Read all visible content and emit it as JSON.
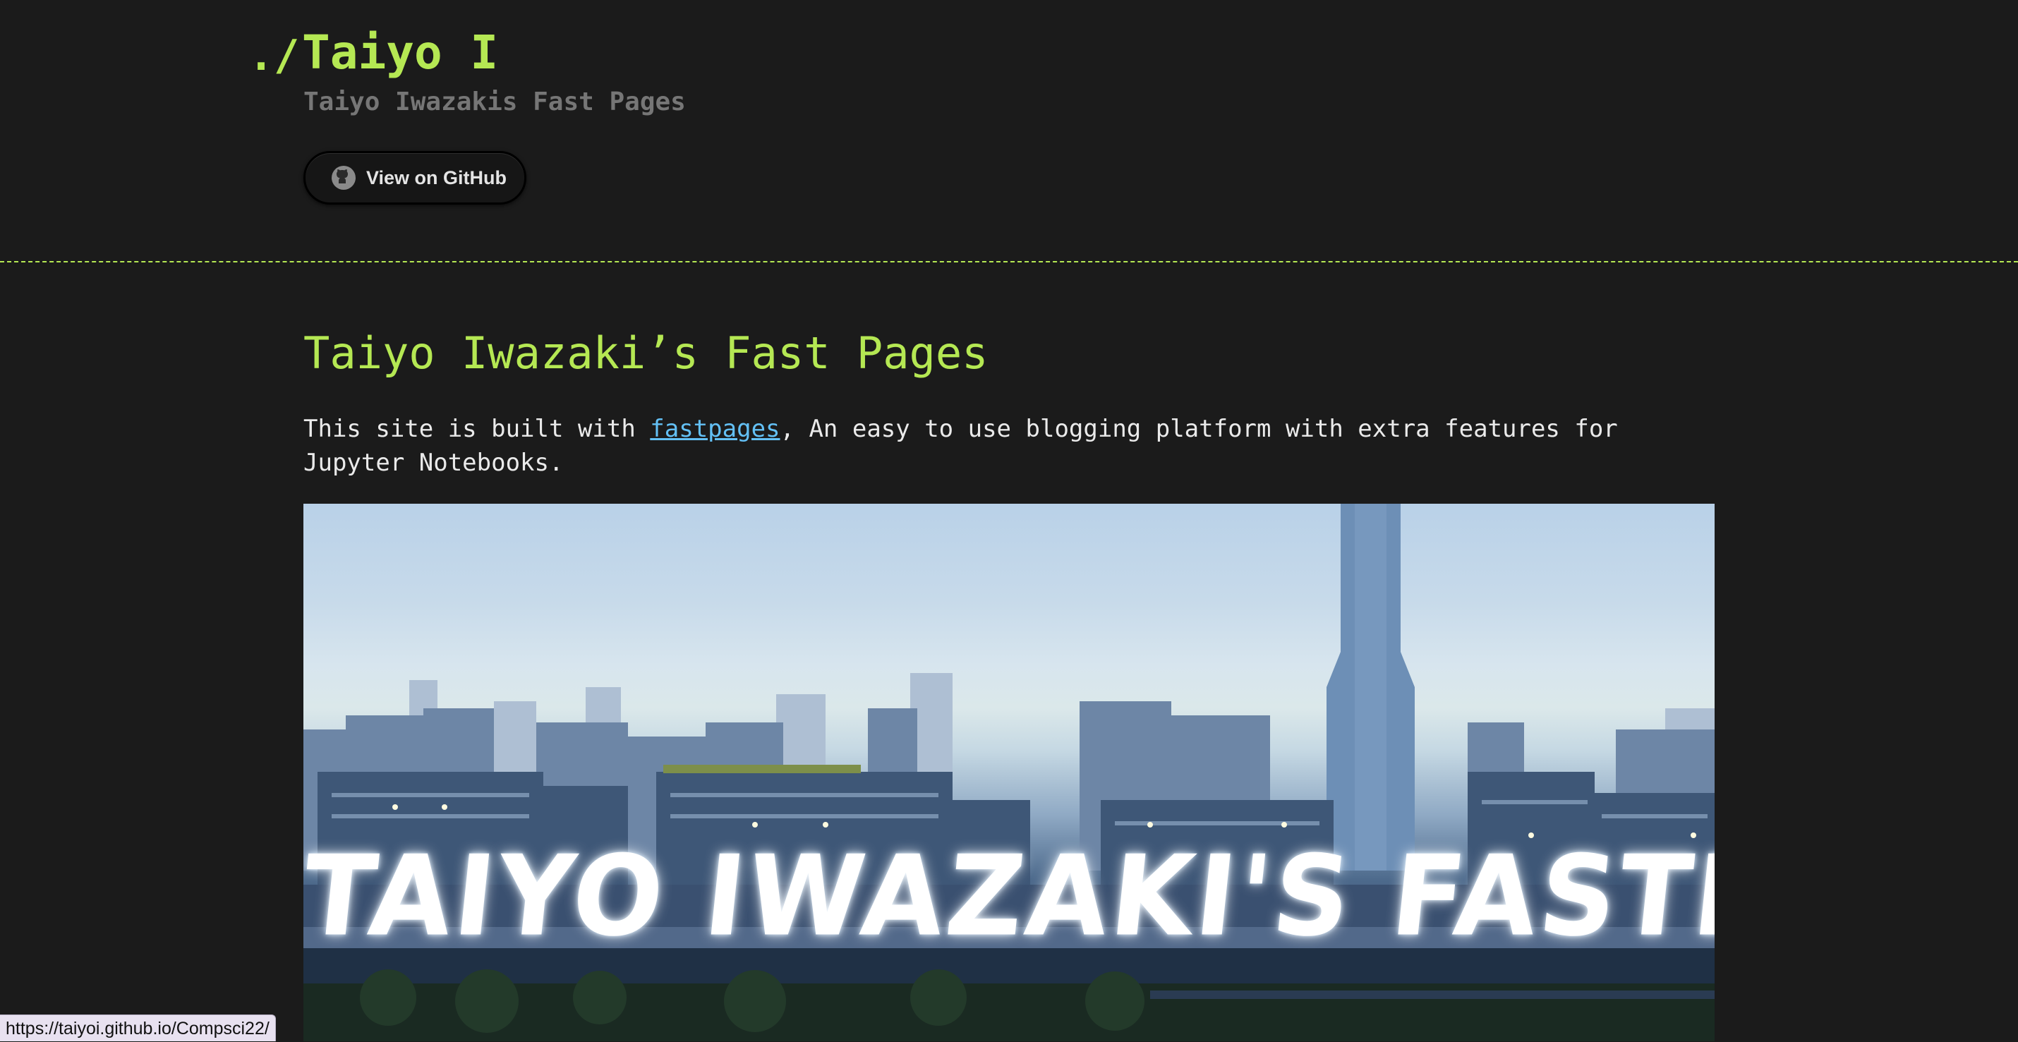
{
  "header": {
    "prompt": "./",
    "title": "Taiyo I",
    "subtitle": "Taiyo Iwazakis Fast Pages",
    "github_button": "View on GitHub"
  },
  "main": {
    "title": "Taiyo Iwazaki’s Fast Pages",
    "intro_before": "This site is built with ",
    "intro_link": "fastpages",
    "intro_after": ", An easy to use blogging platform with extra features for Jupyter Notebooks.",
    "banner_text": "TAIYO IWAZAKI'S FASTPAGES"
  },
  "status_bar": {
    "url": "https://taiyoi.github.io/Compsci22/"
  },
  "colors": {
    "accent": "#b5e853",
    "background": "#1b1b1b",
    "link": "#63c0f5"
  }
}
